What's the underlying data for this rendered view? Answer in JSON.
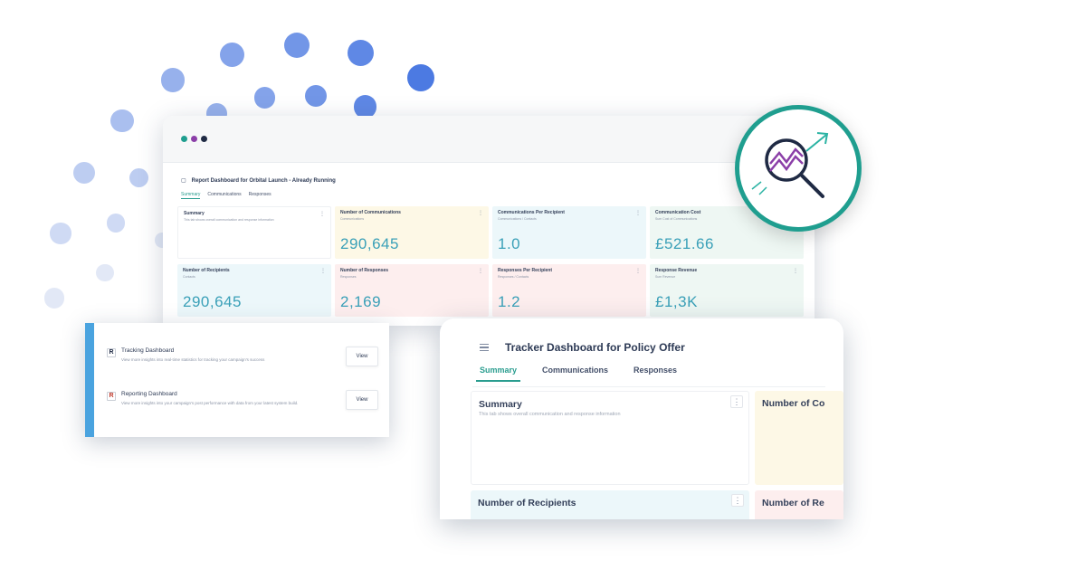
{
  "colors": {
    "teal": "#2a9d8f",
    "blue_accent": "#4aa3df",
    "value_blue": "#3aa0b8",
    "card_yellow": "#fdf8e6",
    "card_pink": "#fdeeee",
    "card_cyan": "#ecf7fa",
    "card_mint": "#eef7f3"
  },
  "main_window": {
    "title": "Report Dashboard for Orbital Launch - Already Running",
    "tabs": [
      "Summary",
      "Communications",
      "Responses"
    ],
    "cards": [
      {
        "title": "Summary",
        "subtitle": "This tab shows overall communication and response information",
        "value": ""
      },
      {
        "title": "Number of Communications",
        "subtitle": "Communications",
        "value": "290,645"
      },
      {
        "title": "Communications Per Recipient",
        "subtitle": "Communications / Contacts",
        "value": "1.0"
      },
      {
        "title": "Communication Cost",
        "subtitle": "Sum Cost of Communications",
        "value": "£521.66"
      },
      {
        "title": "Number of Recipients",
        "subtitle": "Contacts",
        "value": "290,645"
      },
      {
        "title": "Number of Responses",
        "subtitle": "Responses",
        "value": "2,169"
      },
      {
        "title": "Responses Per Recipient",
        "subtitle": "Responses / Contacts",
        "value": "1.2"
      },
      {
        "title": "Response Revenue",
        "subtitle": "Sum Revenue",
        "value": "£1,3K"
      }
    ]
  },
  "badge": {
    "icon": "magnifier-trend-icon"
  },
  "list_panel": {
    "items": [
      {
        "name": "Tracking Dashboard",
        "description": "View more insights into real-time statistics for tracking your campaign's success",
        "action": "View"
      },
      {
        "name": "Reporting Dashboard",
        "description": "View more insights into your campaign's post performance with data from your latest system build.",
        "action": "View"
      }
    ]
  },
  "tablet": {
    "title": "Tracker Dashboard for Policy Offer",
    "tabs": [
      "Summary",
      "Communications",
      "Responses"
    ],
    "cards": [
      {
        "title": "Summary",
        "subtitle": "This tab shows overall communication and response information"
      },
      {
        "title": "Number of Co"
      },
      {
        "title": "Number of Recipients"
      },
      {
        "title": "Number of Re"
      }
    ],
    "kebab": "⋮"
  }
}
